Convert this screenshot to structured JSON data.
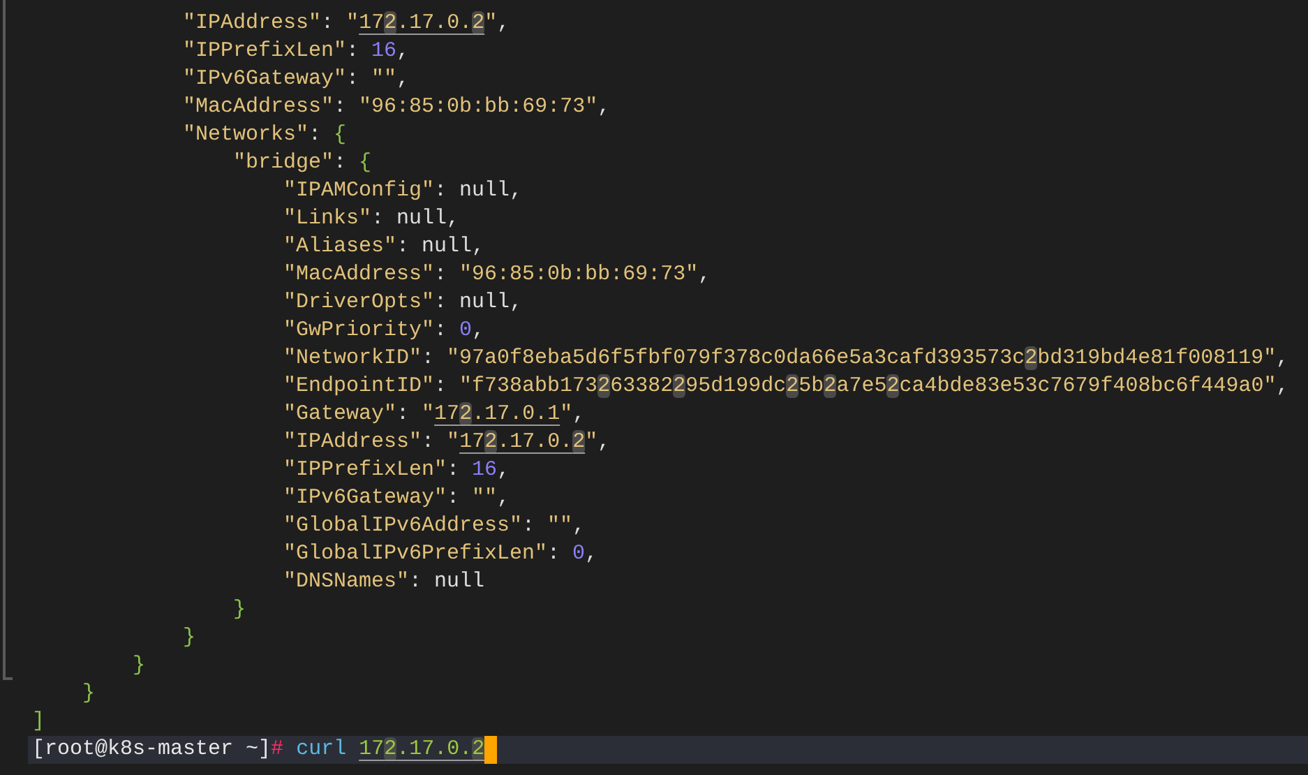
{
  "document": [
    {
      "children": [
        {
          "children": [
            {
              "children": [
                {
                  "tokens": [
                    {
                      "kind": "key",
                      "text": "\"IPAddress\""
                    },
                    {
                      "kind": "punct",
                      "text": ": "
                    },
                    {
                      "kind": "string",
                      "parts": [
                        {
                          "text": "\"",
                          "link": false,
                          "match": false
                        },
                        {
                          "text": "17",
                          "link": true,
                          "match": false
                        },
                        {
                          "text": "2",
                          "link": true,
                          "match": true
                        },
                        {
                          "text": ".17.0.",
                          "link": true,
                          "match": false
                        },
                        {
                          "text": "2",
                          "link": true,
                          "match": true
                        },
                        {
                          "text": "\"",
                          "link": false,
                          "match": false
                        }
                      ]
                    },
                    {
                      "kind": "punct",
                      "text": ","
                    }
                  ]
                },
                {
                  "tokens": [
                    {
                      "kind": "key",
                      "text": "\"IPPrefixLen\""
                    },
                    {
                      "kind": "punct",
                      "text": ": "
                    },
                    {
                      "kind": "number",
                      "text": "16"
                    },
                    {
                      "kind": "punct",
                      "text": ","
                    }
                  ]
                },
                {
                  "tokens": [
                    {
                      "kind": "key",
                      "text": "\"IPv6Gateway\""
                    },
                    {
                      "kind": "punct",
                      "text": ": "
                    },
                    {
                      "kind": "string",
                      "text": "\"\""
                    },
                    {
                      "kind": "punct",
                      "text": ","
                    }
                  ]
                },
                {
                  "tokens": [
                    {
                      "kind": "key",
                      "text": "\"MacAddress\""
                    },
                    {
                      "kind": "punct",
                      "text": ": "
                    },
                    {
                      "kind": "string",
                      "text": "\"96:85:0b:bb:69:73\""
                    },
                    {
                      "kind": "punct",
                      "text": ","
                    }
                  ]
                },
                {
                  "tokens": [
                    {
                      "kind": "key",
                      "text": "\"Networks\""
                    },
                    {
                      "kind": "punct",
                      "text": ": "
                    },
                    {
                      "kind": "brace",
                      "text": "{"
                    }
                  ],
                  "children": [
                    {
                      "tokens": [
                        {
                          "kind": "key",
                          "text": "\"bridge\""
                        },
                        {
                          "kind": "punct",
                          "text": ": "
                        },
                        {
                          "kind": "brace",
                          "text": "{"
                        }
                      ],
                      "children": [
                        {
                          "tokens": [
                            {
                              "kind": "key",
                              "text": "\"IPAMConfig\""
                            },
                            {
                              "kind": "punct",
                              "text": ": "
                            },
                            {
                              "kind": "null",
                              "text": "null"
                            },
                            {
                              "kind": "punct",
                              "text": ","
                            }
                          ]
                        },
                        {
                          "tokens": [
                            {
                              "kind": "key",
                              "text": "\"Links\""
                            },
                            {
                              "kind": "punct",
                              "text": ": "
                            },
                            {
                              "kind": "null",
                              "text": "null"
                            },
                            {
                              "kind": "punct",
                              "text": ","
                            }
                          ]
                        },
                        {
                          "tokens": [
                            {
                              "kind": "key",
                              "text": "\"Aliases\""
                            },
                            {
                              "kind": "punct",
                              "text": ": "
                            },
                            {
                              "kind": "null",
                              "text": "null"
                            },
                            {
                              "kind": "punct",
                              "text": ","
                            }
                          ]
                        },
                        {
                          "tokens": [
                            {
                              "kind": "key",
                              "text": "\"MacAddress\""
                            },
                            {
                              "kind": "punct",
                              "text": ": "
                            },
                            {
                              "kind": "string",
                              "text": "\"96:85:0b:bb:69:73\""
                            },
                            {
                              "kind": "punct",
                              "text": ","
                            }
                          ]
                        },
                        {
                          "tokens": [
                            {
                              "kind": "key",
                              "text": "\"DriverOpts\""
                            },
                            {
                              "kind": "punct",
                              "text": ": "
                            },
                            {
                              "kind": "null",
                              "text": "null"
                            },
                            {
                              "kind": "punct",
                              "text": ","
                            }
                          ]
                        },
                        {
                          "tokens": [
                            {
                              "kind": "key",
                              "text": "\"GwPriority\""
                            },
                            {
                              "kind": "punct",
                              "text": ": "
                            },
                            {
                              "kind": "number",
                              "text": "0"
                            },
                            {
                              "kind": "punct",
                              "text": ","
                            }
                          ]
                        },
                        {
                          "tokens": [
                            {
                              "kind": "key",
                              "text": "\"NetworkID\""
                            },
                            {
                              "kind": "punct",
                              "text": ": "
                            },
                            {
                              "kind": "string",
                              "parts": [
                                {
                                  "text": "\"97a0f8eba5d6f5fbf079f378c0da66e5a3cafd393573c",
                                  "link": false,
                                  "match": false
                                },
                                {
                                  "text": "2",
                                  "link": false,
                                  "match": true
                                },
                                {
                                  "text": "bd319bd4e81f008119\"",
                                  "link": false,
                                  "match": false
                                }
                              ]
                            },
                            {
                              "kind": "punct",
                              "text": ","
                            }
                          ]
                        },
                        {
                          "tokens": [
                            {
                              "kind": "key",
                              "text": "\"EndpointID\""
                            },
                            {
                              "kind": "punct",
                              "text": ": "
                            },
                            {
                              "kind": "string",
                              "parts": [
                                {
                                  "text": "\"f738abb173",
                                  "link": false,
                                  "match": false
                                },
                                {
                                  "text": "2",
                                  "link": false,
                                  "match": true
                                },
                                {
                                  "text": "63382",
                                  "link": false,
                                  "match": false
                                },
                                {
                                  "text": "2",
                                  "link": false,
                                  "match": true
                                },
                                {
                                  "text": "95d199dc",
                                  "link": false,
                                  "match": false
                                },
                                {
                                  "text": "2",
                                  "link": false,
                                  "match": true
                                },
                                {
                                  "text": "5b",
                                  "link": false,
                                  "match": false
                                },
                                {
                                  "text": "2",
                                  "link": false,
                                  "match": true
                                },
                                {
                                  "text": "a7e5",
                                  "link": false,
                                  "match": false
                                },
                                {
                                  "text": "2",
                                  "link": false,
                                  "match": true
                                },
                                {
                                  "text": "ca4bde83e53c7679f408bc6f449a0\"",
                                  "link": false,
                                  "match": false
                                }
                              ]
                            },
                            {
                              "kind": "punct",
                              "text": ","
                            }
                          ]
                        },
                        {
                          "tokens": [
                            {
                              "kind": "key",
                              "text": "\"Gateway\""
                            },
                            {
                              "kind": "punct",
                              "text": ": "
                            },
                            {
                              "kind": "string",
                              "parts": [
                                {
                                  "text": "\"",
                                  "link": false,
                                  "match": false
                                },
                                {
                                  "text": "17",
                                  "link": true,
                                  "match": false
                                },
                                {
                                  "text": "2",
                                  "link": true,
                                  "match": true
                                },
                                {
                                  "text": ".17.0.1",
                                  "link": true,
                                  "match": false
                                },
                                {
                                  "text": "\"",
                                  "link": false,
                                  "match": false
                                }
                              ]
                            },
                            {
                              "kind": "punct",
                              "text": ","
                            }
                          ]
                        },
                        {
                          "tokens": [
                            {
                              "kind": "key",
                              "text": "\"IPAddress\""
                            },
                            {
                              "kind": "punct",
                              "text": ": "
                            },
                            {
                              "kind": "string",
                              "parts": [
                                {
                                  "text": "\"",
                                  "link": false,
                                  "match": false
                                },
                                {
                                  "text": "17",
                                  "link": true,
                                  "match": false
                                },
                                {
                                  "text": "2",
                                  "link": true,
                                  "match": true
                                },
                                {
                                  "text": ".17.0.",
                                  "link": true,
                                  "match": false
                                },
                                {
                                  "text": "2",
                                  "link": true,
                                  "match": true
                                },
                                {
                                  "text": "\"",
                                  "link": false,
                                  "match": false
                                }
                              ]
                            },
                            {
                              "kind": "punct",
                              "text": ","
                            }
                          ]
                        },
                        {
                          "tokens": [
                            {
                              "kind": "key",
                              "text": "\"IPPrefixLen\""
                            },
                            {
                              "kind": "punct",
                              "text": ": "
                            },
                            {
                              "kind": "number",
                              "text": "16"
                            },
                            {
                              "kind": "punct",
                              "text": ","
                            }
                          ]
                        },
                        {
                          "tokens": [
                            {
                              "kind": "key",
                              "text": "\"IPv6Gateway\""
                            },
                            {
                              "kind": "punct",
                              "text": ": "
                            },
                            {
                              "kind": "string",
                              "text": "\"\""
                            },
                            {
                              "kind": "punct",
                              "text": ","
                            }
                          ]
                        },
                        {
                          "tokens": [
                            {
                              "kind": "key",
                              "text": "\"GlobalIPv6Address\""
                            },
                            {
                              "kind": "punct",
                              "text": ": "
                            },
                            {
                              "kind": "string",
                              "text": "\"\""
                            },
                            {
                              "kind": "punct",
                              "text": ","
                            }
                          ]
                        },
                        {
                          "tokens": [
                            {
                              "kind": "key",
                              "text": "\"GlobalIPv6PrefixLen\""
                            },
                            {
                              "kind": "punct",
                              "text": ": "
                            },
                            {
                              "kind": "number",
                              "text": "0"
                            },
                            {
                              "kind": "punct",
                              "text": ","
                            }
                          ]
                        },
                        {
                          "tokens": [
                            {
                              "kind": "key",
                              "text": "\"DNSNames\""
                            },
                            {
                              "kind": "punct",
                              "text": ": "
                            },
                            {
                              "kind": "null",
                              "text": "null"
                            }
                          ]
                        }
                      ]
                    },
                    {
                      "tokens": [
                        {
                          "kind": "brace",
                          "text": "}"
                        }
                      ]
                    }
                  ]
                },
                {
                  "tokens": [
                    {
                      "kind": "brace",
                      "text": "}"
                    }
                  ]
                }
              ]
            },
            {
              "tokens": [
                {
                  "kind": "brace",
                  "text": "}"
                }
              ]
            }
          ]
        },
        {
          "tokens": [
            {
              "kind": "brace",
              "text": "}"
            }
          ]
        }
      ]
    },
    {
      "tokens": [
        {
          "kind": "brace",
          "text": "]"
        }
      ]
    }
  ],
  "prompt": {
    "user_host": "[root@k8s-master ~]",
    "symbol": "#",
    "command": "curl",
    "argument": [
      {
        "text": "17",
        "match": false
      },
      {
        "text": "2",
        "match": true
      },
      {
        "text": ".17.0.",
        "match": false
      },
      {
        "text": "2",
        "match": true
      }
    ]
  }
}
